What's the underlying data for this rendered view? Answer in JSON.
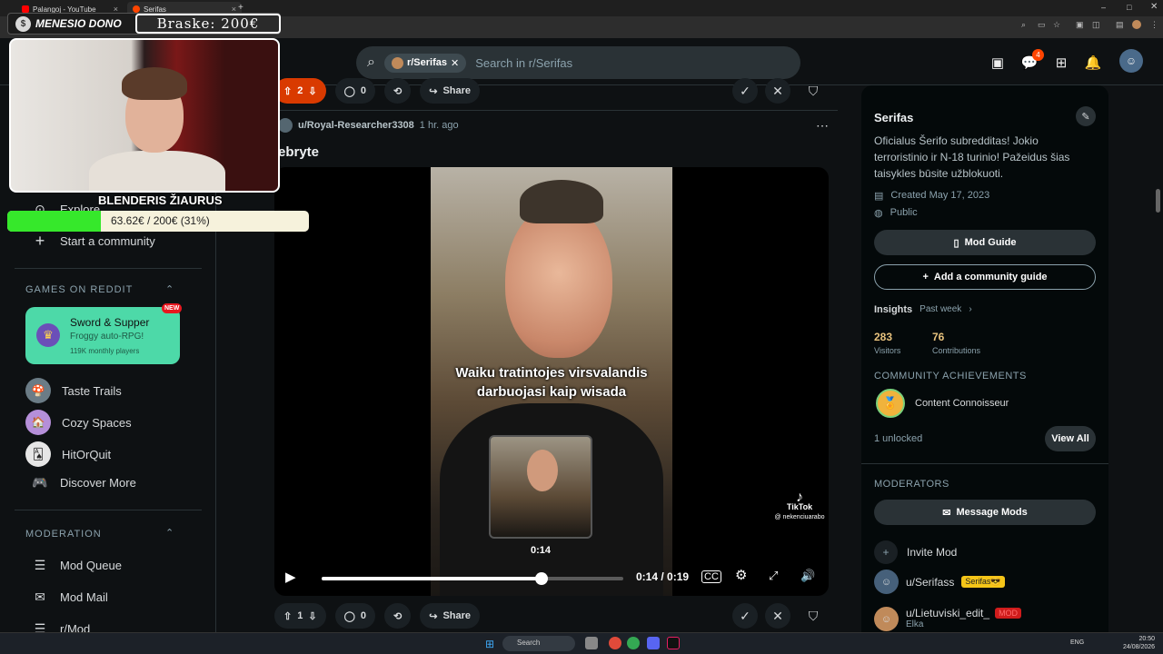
{
  "browser": {
    "tabs": [
      {
        "label": "Palangoj - YouTube"
      },
      {
        "label": "Serifas"
      }
    ]
  },
  "header": {
    "search_chip": "r/Serifas",
    "search_placeholder": "Search in r/Serifas",
    "notification_count": "4"
  },
  "sidebar": {
    "top_items": [
      {
        "label": "Explore",
        "icon": "explore-icon"
      },
      {
        "label": "Start a community",
        "icon": "plus-icon"
      }
    ],
    "games_header": "GAMES ON REDDIT",
    "featured_game": {
      "title": "Sword & Supper",
      "subtitle": "Froggy auto-RPG!",
      "players": "119K monthly players",
      "badge": "NEW"
    },
    "games": [
      {
        "label": "Taste Trails"
      },
      {
        "label": "Cozy Spaces"
      },
      {
        "label": "HitOrQuit"
      },
      {
        "label": "Discover More"
      }
    ],
    "moderation_header": "MODERATION",
    "moderation": [
      {
        "label": "Mod Queue"
      },
      {
        "label": "Mod Mail"
      },
      {
        "label": "r/Mod"
      }
    ]
  },
  "post_prev": {
    "votes": "2",
    "comments": "0",
    "share": "Share"
  },
  "post": {
    "author": "u/Royal-Researcher3308",
    "time": "1 hr. ago",
    "title": "ebryte",
    "caption_line1": "Waiku tratintojes virsvalandis",
    "caption_line2": "darbuojasi kaip wisada",
    "watermark": "TikTok",
    "watermark_handle": "@ nekenciuarabo",
    "preview_time": "0:14",
    "video_time": "0:14 / 0:19",
    "progress": 0.73,
    "votes": "1",
    "comments": "0",
    "share": "Share"
  },
  "community": {
    "name": "Serifas",
    "description": "Oficialus Šerifo subredditas! Jokio terroristinio ir N-18 turinio! Pažeidus šias taisykles būsite užblokuoti.",
    "created": "Created May 17, 2023",
    "visibility": "Public",
    "mod_guide": "Mod Guide",
    "add_guide": "Add a community guide",
    "insights_label": "Insights",
    "insights_range": "Past week",
    "visitors": "283",
    "visitors_label": "Visitors",
    "contributions": "76",
    "contributions_label": "Contributions",
    "achievements_header": "COMMUNITY ACHIEVEMENTS",
    "achievement": "Content Connoisseur",
    "unlocked": "1 unlocked",
    "view_all": "View All",
    "moderators_header": "MODERATORS",
    "message_mods": "Message Mods",
    "invite_mod": "Invite Mod",
    "mods": [
      {
        "name": "u/Serifass",
        "flair": "Serifas😎"
      },
      {
        "name": "u/Lietuviski_edit_",
        "flair": "MOD",
        "sub": "Elka"
      }
    ]
  },
  "overlay": {
    "donation_label": "MENESIO DONO",
    "braske": "Braske: 200€",
    "streamer": "BLENDERIS ŽIAURUS",
    "goal_text": "63.62€ / 200€ (31%)",
    "goal_fraction": 0.31
  },
  "taskbar": {
    "search": "Search",
    "lang": "ENG",
    "time": "20:50",
    "date": "24/08/2026"
  },
  "colors": {
    "upvote_active": "#d93a00",
    "game_card": "#4dd9a8",
    "goal_fill": "#36e82b",
    "stat": "#e8c27d"
  }
}
